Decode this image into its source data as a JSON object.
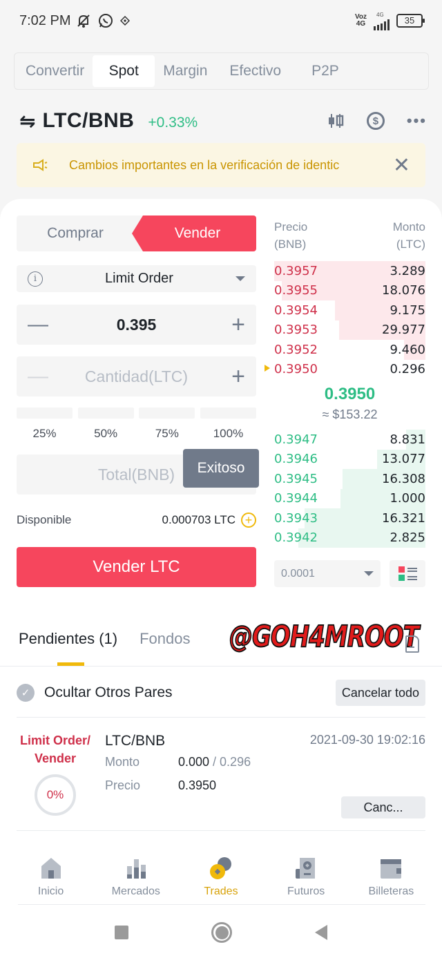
{
  "status_bar": {
    "time": "7:02 PM",
    "network_label_top": "Voz",
    "network_label_bottom": "4G",
    "signal_label": "4G",
    "battery": "35"
  },
  "mode_tabs": [
    {
      "label": "Convertir",
      "active": false
    },
    {
      "label": "Spot",
      "active": true
    },
    {
      "label": "Margin",
      "active": false
    },
    {
      "label": "Efectivo",
      "active": false
    },
    {
      "label": "P2P",
      "active": false
    }
  ],
  "pair": {
    "name": "LTC/BNB",
    "change": "+0.33%",
    "change_color": "#2ebd85"
  },
  "banner": {
    "text": "Cambios importantes en la verificación de identic"
  },
  "order_form": {
    "buy_label": "Comprar",
    "sell_label": "Vender",
    "order_type": "Limit Order",
    "price_value": "0.395",
    "amount_placeholder": "Cantidad(LTC)",
    "percent_options": [
      "25%",
      "50%",
      "75%",
      "100%"
    ],
    "total_placeholder": "Total(BNB)",
    "toast": "Exitoso",
    "available_label": "Disponible",
    "available_value": "0.000703 LTC",
    "submit_label": "Vender LTC",
    "sell_color": "#f6465d"
  },
  "order_book": {
    "price_header": "Precio",
    "price_unit": "(BNB)",
    "amount_header": "Monto",
    "amount_unit": "(LTC)",
    "asks": [
      {
        "price": "0.3957",
        "amount": "3.289",
        "depth": 1.0
      },
      {
        "price": "0.3955",
        "amount": "18.076",
        "depth": 0.95
      },
      {
        "price": "0.3954",
        "amount": "9.175",
        "depth": 0.6
      },
      {
        "price": "0.3953",
        "amount": "29.977",
        "depth": 0.57
      },
      {
        "price": "0.3952",
        "amount": "9.460",
        "depth": 0.14
      },
      {
        "price": "0.3950",
        "amount": "0.296",
        "depth": 0.0,
        "marked": true
      }
    ],
    "last_price": "0.3950",
    "last_price_usd": "≈ $153.22",
    "bids": [
      {
        "price": "0.3947",
        "amount": "8.831",
        "depth": 0.13
      },
      {
        "price": "0.3946",
        "amount": "13.077",
        "depth": 0.32
      },
      {
        "price": "0.3945",
        "amount": "16.308",
        "depth": 0.55
      },
      {
        "price": "0.3944",
        "amount": "1.000",
        "depth": 0.56
      },
      {
        "price": "0.3943",
        "amount": "16.321",
        "depth": 0.8
      },
      {
        "price": "0.3942",
        "amount": "2.825",
        "depth": 0.84
      }
    ],
    "precision": "0.0001"
  },
  "orders": {
    "tabs": [
      {
        "label": "Pendientes (1)",
        "active": true
      },
      {
        "label": "Fondos",
        "active": false
      }
    ],
    "watermark": "@GOH4MROOT",
    "hide_other_pairs_label": "Ocultar Otros Pares",
    "cancel_all_label": "Cancelar todo",
    "items": [
      {
        "type_line1": "Limit Order/",
        "type_line2": "Vender",
        "progress": "0%",
        "pair": "LTC/BNB",
        "time": "2021-09-30 19:02:16",
        "amount_label": "Monto",
        "amount_filled": "0.000",
        "amount_total": " / 0.296",
        "price_label": "Precio",
        "price": "0.3950",
        "cancel_label": "Canc..."
      }
    ]
  },
  "bottom_nav": [
    {
      "label": "Inicio",
      "icon": "home-icon",
      "active": false
    },
    {
      "label": "Mercados",
      "icon": "markets-icon",
      "active": false
    },
    {
      "label": "Trades",
      "icon": "trades-icon",
      "active": true
    },
    {
      "label": "Futuros",
      "icon": "futures-icon",
      "active": false
    },
    {
      "label": "Billeteras",
      "icon": "wallet-icon",
      "active": false
    }
  ],
  "accent_color": "#f0b90b"
}
